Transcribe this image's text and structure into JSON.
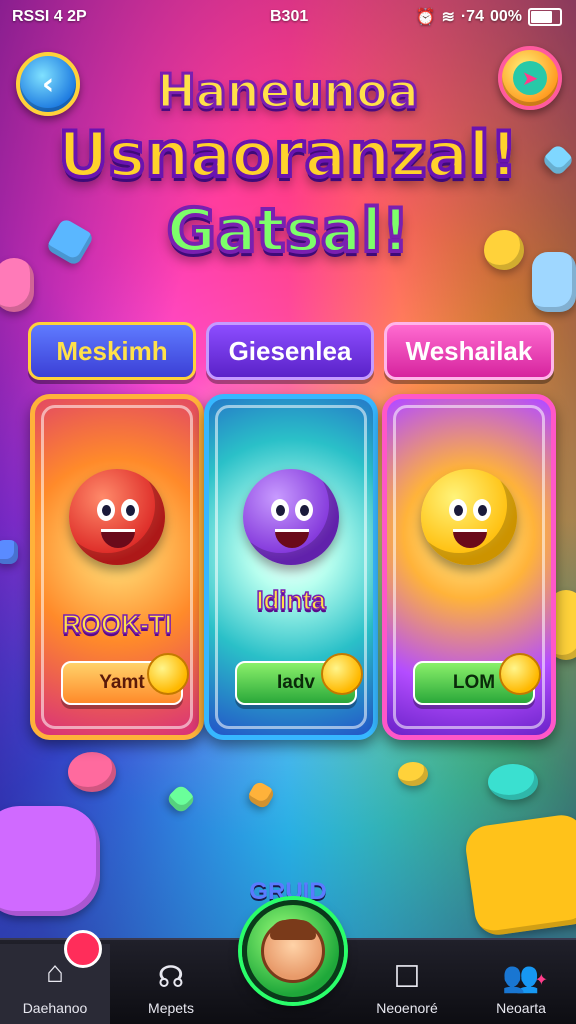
{
  "status_bar": {
    "left": "RSSI 4  2P",
    "center": "B301",
    "right": "00%",
    "right_signal": "·74"
  },
  "header": {
    "back_icon": "back-arrow-icon",
    "share_icon": "share-icon",
    "title_line1": "Haneunoa",
    "title_line2": "Usnaoranzal!",
    "title_line3": "Gatsal!"
  },
  "tabs": [
    {
      "label": "Meskimh"
    },
    {
      "label": "Giesenlea"
    },
    {
      "label": "Weshailak"
    }
  ],
  "cards": [
    {
      "character": "red-monster",
      "label": "ROOK-TI",
      "button": "Yamt"
    },
    {
      "character": "purple-monster",
      "label": "Idinta",
      "button": "Iadv"
    },
    {
      "character": "yellow-monster",
      "label": "",
      "button": "LOM"
    }
  ],
  "footer": {
    "section_label": "GRUID"
  },
  "nav": [
    {
      "label": "Daehanoo",
      "icon": "home-icon"
    },
    {
      "label": "Mepets",
      "icon": "headset-icon"
    },
    {
      "label": "",
      "icon": "profile-avatar"
    },
    {
      "label": "Neoenoré",
      "icon": "square-icon"
    },
    {
      "label": "Neoarta",
      "icon": "people-icon"
    }
  ],
  "colors": {
    "title_yellow": "#ffe14a",
    "title_green": "#7dff6a",
    "outline_purple": "#7a1fb0",
    "accent_pink": "#ff3d8b"
  }
}
